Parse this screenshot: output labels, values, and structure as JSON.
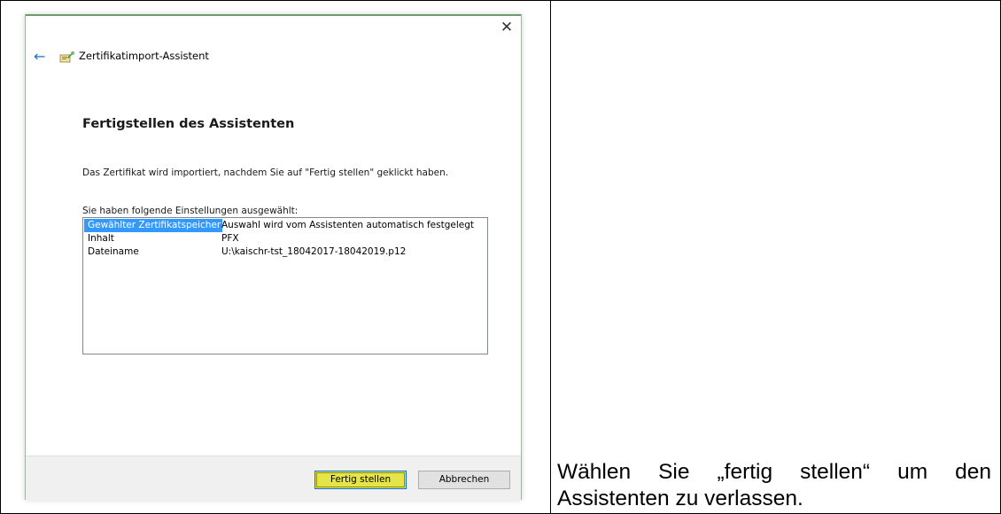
{
  "dialog": {
    "title": "Zertifikatimport-Assistent",
    "close_glyph": "✕",
    "back_glyph": "←",
    "heading": "Fertigstellen des Assistenten",
    "description": "Das Zertifikat wird importiert, nachdem Sie auf \"Fertig stellen\" geklickt haben.",
    "list_label": "Sie haben folgende Einstellungen ausgewählt:",
    "settings": [
      {
        "key": "Gewählter Zertifikatspeicher",
        "value": "Auswahl wird vom Assistenten automatisch festgelegt",
        "selected": true
      },
      {
        "key": "Inhalt",
        "value": "PFX",
        "selected": false
      },
      {
        "key": "Dateiname",
        "value": "U:\\kaischr-tst_18042017-18042019.p12",
        "selected": false
      }
    ],
    "buttons": {
      "finish": "Fertig stellen",
      "cancel": "Abbrechen"
    }
  },
  "instruction_text": "Wählen Sie „fertig stellen“ um den Assistenten zu verlassen.",
  "colors": {
    "selection": "#3399ff",
    "finish_button": "#e5e54a",
    "back_arrow": "#1c6fd2"
  },
  "icons": {
    "back": "back-arrow-icon",
    "wizard": "certificate-wizard-icon",
    "close": "close-icon"
  }
}
